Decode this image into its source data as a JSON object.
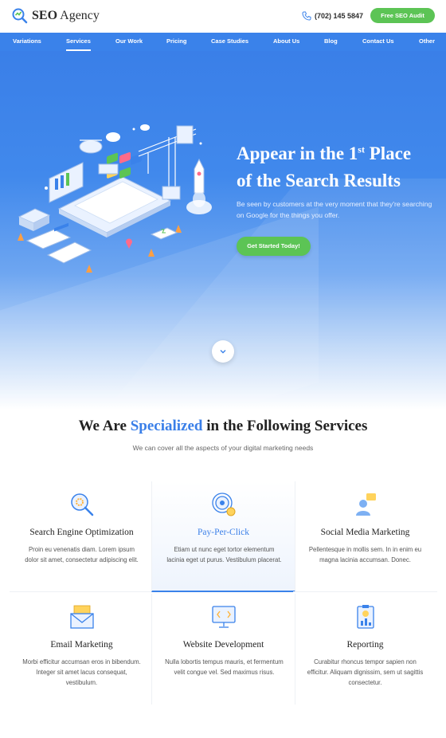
{
  "header": {
    "logo_text_bold": "SEO",
    "logo_text_rest": " Agency",
    "phone": "(702) 145 5847",
    "audit_button": "Free SEO Audit"
  },
  "nav": {
    "items": [
      "Variations",
      "Services",
      "Our Work",
      "Pricing",
      "Case Studies",
      "About Us",
      "Blog",
      "Contact Us",
      "Other"
    ],
    "active": "Services"
  },
  "hero": {
    "title_line1_pre": "Appear in the 1",
    "title_sup": "st",
    "title_line1_post": " Place",
    "title_line2": "of the Search Results",
    "subtitle": "Be seen by customers at the very moment that they're searching on Google for the things you offer.",
    "cta": "Get Started Today!"
  },
  "services": {
    "title_pre": "We Are ",
    "title_highlight": "Specialized",
    "title_post": " in the Following Services",
    "subtitle": "We can cover all the aspects of your digital marketing needs",
    "items": [
      {
        "title": "Search Engine Optimization",
        "desc": "Proin eu venenatis diam. Lorem ipsum dolor sit amet, consectetur adipiscing elit.",
        "icon": "magnifier-gear-icon"
      },
      {
        "title": "Pay-Per-Click",
        "desc": "Etiam ut nunc eget tortor elementum lacinia eget ut purus. Vestibulum placerat.",
        "icon": "target-coin-icon"
      },
      {
        "title": "Social Media Marketing",
        "desc": "Pellentesque in mollis sem. In in enim eu magna lacinia accumsan. Donec.",
        "icon": "person-chat-icon"
      },
      {
        "title": "Email Marketing",
        "desc": "Morbi efficitur accumsan eros in bibendum. Integer sit amet lacus consequat, vestibulum.",
        "icon": "envelope-icon"
      },
      {
        "title": "Website Development",
        "desc": "Nulla lobortis tempus mauris, et fermentum velit congue vel. Sed maximus risus.",
        "icon": "monitor-code-icon"
      },
      {
        "title": "Reporting",
        "desc": "Curabitur rhoncus tempor sapien non efficitur. Aliquam dignissim, sem ut sagittis consectetur.",
        "icon": "clipboard-chart-icon"
      }
    ]
  },
  "colors": {
    "primary_blue": "#3a82ea",
    "cta_green": "#5cc455"
  }
}
